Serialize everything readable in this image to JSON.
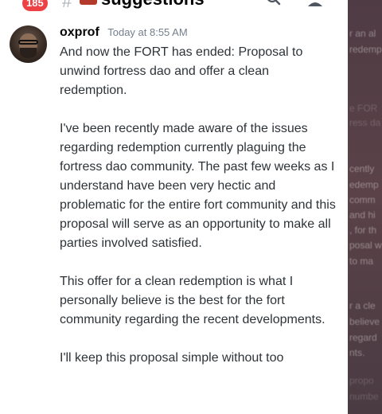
{
  "header": {
    "notification_count": "185",
    "channel_hash": "#",
    "channel_name": "suggestions"
  },
  "message": {
    "username": "oxprof",
    "timestamp": "Today at 8:55 AM",
    "paragraphs": [
      "And now the FORT has ended: Proposal to unwind fortress dao and offer a clean redemption.",
      "I've been recently made aware of the issues regarding redemption currently plaguing the fortress dao community. The past few weeks as I understand have been very hectic and problematic for the entire fort community and this proposal will serve as an opportunity to make all parties involved satisfied.",
      "This offer for a clean redemption is what I personally believe is the best for the fort community regarding the recent developments.",
      "I'll keep this proposal simple without too"
    ]
  },
  "side_panel": {
    "fragments": [
      "r an al",
      "redemp",
      "",
      "e FOR",
      "ress da",
      "cently",
      "edemp",
      "comm",
      "and hi",
      ", for th",
      "posal w",
      "to ma",
      "r a cle",
      "believe",
      "regard",
      "nts.",
      "propo",
      "numbe"
    ]
  },
  "colors": {
    "badge": "#ed4245",
    "message_bg": "#ffffff",
    "side_panel": "#4f3b44",
    "text": "#2e3338",
    "timestamp": "#747f8d"
  }
}
